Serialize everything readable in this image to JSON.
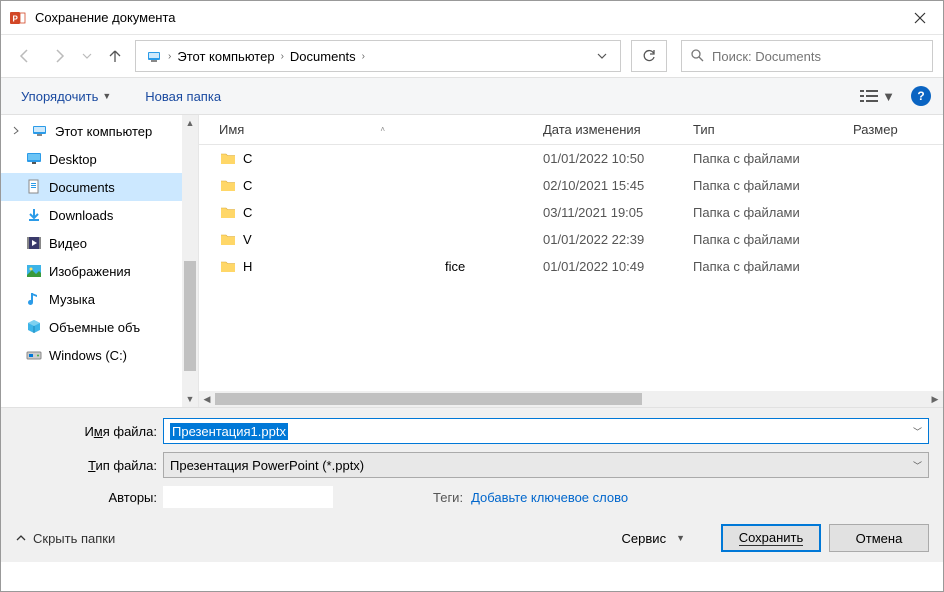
{
  "window": {
    "title": "Сохранение документа"
  },
  "breadcrumb": {
    "root_label": "Этот компьютер",
    "current_label": "Documents"
  },
  "search": {
    "placeholder": "Поиск: Documents"
  },
  "toolbar": {
    "organize": "Упорядочить",
    "new_folder": "Новая папка"
  },
  "columns": {
    "name": "Имя",
    "date": "Дата изменения",
    "type": "Тип",
    "size": "Размер"
  },
  "sidebar": {
    "items": [
      {
        "label": "Этот компьютер",
        "icon": "pc"
      },
      {
        "label": "Desktop",
        "icon": "desktop"
      },
      {
        "label": "Documents",
        "icon": "doc",
        "selected": true
      },
      {
        "label": "Downloads",
        "icon": "dl"
      },
      {
        "label": "Видео",
        "icon": "video"
      },
      {
        "label": "Изображения",
        "icon": "img"
      },
      {
        "label": "Музыка",
        "icon": "music"
      },
      {
        "label": "Объемные объ",
        "icon": "3d"
      },
      {
        "label": "Windows (C:)",
        "icon": "drive"
      }
    ]
  },
  "files": [
    {
      "name": "C",
      "date": "01/01/2022 10:50",
      "type": "Папка с файлами"
    },
    {
      "name": "C",
      "date": "02/10/2021 15:45",
      "type": "Папка с файлами"
    },
    {
      "name": "C",
      "date": "03/11/2021 19:05",
      "type": "Папка с файлами"
    },
    {
      "name": "V",
      "date": "01/01/2022 22:39",
      "type": "Папка с файлами"
    },
    {
      "name": "H",
      "name_extra": "fice",
      "date": "01/01/2022 10:49",
      "type": "Папка с файлами"
    }
  ],
  "fields": {
    "filename_label_pre": "И",
    "filename_label_ul": "м",
    "filename_label_post": "я файла:",
    "filetype_label_pre": "",
    "filetype_label_ul": "Т",
    "filetype_label_post": "ип файла:",
    "filename_value": "Презентация1.pptx",
    "filetype_value": "Презентация PowerPoint (*.pptx)",
    "authors_label": "Авторы:",
    "tags_label": "Теги:",
    "tags_placeholder": "Добавьте ключевое слово"
  },
  "buttons": {
    "hide_folders": "Скрыть папки",
    "service": "Сервис",
    "save": "Сохранить",
    "cancel": "Отмена"
  }
}
